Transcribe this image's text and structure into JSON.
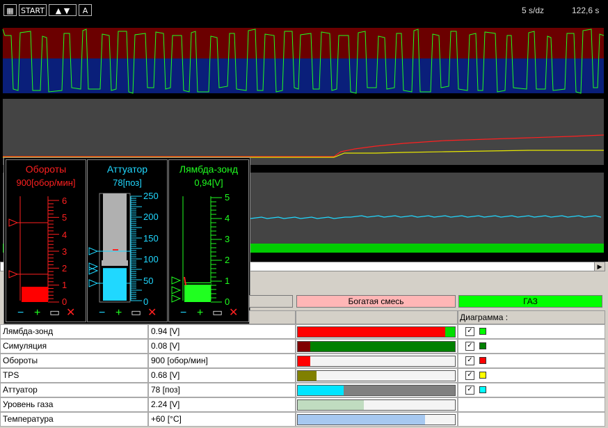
{
  "toolbar": {
    "grid_icon": "grid-icon",
    "start_label": "START",
    "up_label": "▲",
    "down_label": "▼",
    "auto_label": "A",
    "time_scale": "5 s/dz",
    "time_total": "122,6 s"
  },
  "colors": {
    "lambda": "#ff2020",
    "simulation": "#008000",
    "revs": "#ff0000",
    "tps": "#ffff00",
    "actuator": "#00e5ff",
    "gauge_red": "#ff2020",
    "gauge_cyan": "#20d8ff",
    "gauge_green": "#20ff20"
  },
  "gauges": [
    {
      "title": "Обороты",
      "value": "900[обор/мин]",
      "ticks": [
        "6",
        "5",
        "4",
        "3",
        "2",
        "1",
        "0"
      ],
      "level": 0.15
    },
    {
      "title": "Аттуатор",
      "value": "78[поз]",
      "ticks": [
        "250",
        "200",
        "150",
        "100",
        "50",
        "0"
      ],
      "level": 0.312
    },
    {
      "title": "Лямбда-зонд",
      "value": "0,94[V]",
      "ticks": [
        "5",
        "4",
        "3",
        "2",
        "1",
        "0"
      ],
      "level": 0.188
    }
  ],
  "gauge_controls": {
    "minus": "−",
    "plus": "+",
    "rect": "▭",
    "close": "✕"
  },
  "status": {
    "left_cell": "",
    "mixture": "Богатая смесь",
    "fuel": "ГАЗ"
  },
  "table_header": {
    "diagram": "Диаграмма :"
  },
  "rows": [
    {
      "name": "Лямбда-зонд",
      "value": "0.94 [V]",
      "fill": 0.94,
      "fill_color": "#ff0000",
      "rest_color": "#00dd00",
      "checked": "✓",
      "swatch": "#00ff00"
    },
    {
      "name": "Симуляция",
      "value": "0.08 [V]",
      "fill": 0.08,
      "fill_color": "#800000",
      "rest_color": "#008000",
      "checked": "✓",
      "swatch": "#008000"
    },
    {
      "name": "Обороты",
      "value": "900 [обор/мин]",
      "fill": 0.08,
      "fill_color": "#ff0000",
      "rest_color": "#f4f4f4",
      "checked": "✓",
      "swatch": "#ff0000"
    },
    {
      "name": "TPS",
      "value": "0.68 [V]",
      "fill": 0.12,
      "fill_color": "#808000",
      "rest_color": "#f4f4f4",
      "checked": "✓",
      "swatch": "#ffff00"
    },
    {
      "name": "Аттуатор",
      "value": "78 [поз]",
      "fill": 0.29,
      "fill_color": "#00e5ff",
      "rest_color": "#808080",
      "checked": "✓",
      "swatch": "#00ffff"
    },
    {
      "name": "Уровень газа",
      "value": "2.24 [V]",
      "fill": 0.42,
      "fill_color": "#c0dcc0",
      "rest_color": "#f4f4f4",
      "checked": "",
      "swatch": ""
    },
    {
      "name": "Температура",
      "value": "+60 [°C]",
      "fill": 0.81,
      "fill_color": "#a6c8f0",
      "rest_color": "#f4f4f4",
      "checked": "",
      "swatch": ""
    }
  ]
}
